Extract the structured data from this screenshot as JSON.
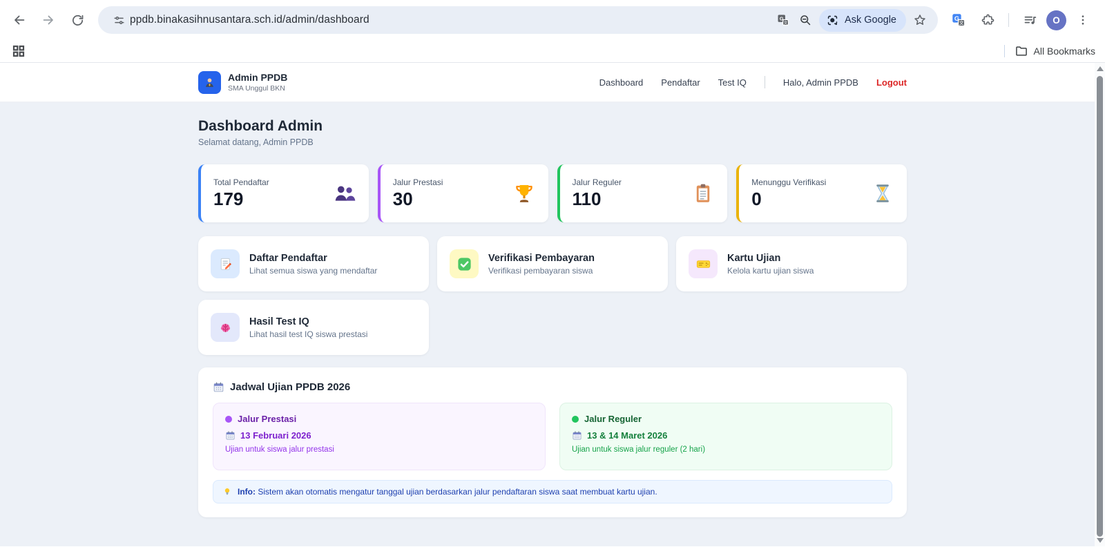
{
  "browser": {
    "url": "ppdb.binakasihnusantara.sch.id/admin/dashboard",
    "ask_google_label": "Ask Google",
    "profile_initial": "O",
    "bookmarks_label": "All Bookmarks",
    "toolbar_icons": [
      "back-icon",
      "forward-icon",
      "reload-icon",
      "site-settings-icon",
      "translate-page-icon",
      "zoom-out-icon",
      "lens-icon",
      "bookmark-star-icon",
      "translate-extension-icon",
      "extensions-icon",
      "playlist-icon",
      "profile-avatar",
      "kebab-menu-icon",
      "apps-grid-icon",
      "folder-icon"
    ]
  },
  "header": {
    "brand_title": "Admin PPDB",
    "brand_subtitle": "SMA Unggul BKN",
    "brand_icon": "office-worker-icon",
    "nav": [
      {
        "label": "Dashboard"
      },
      {
        "label": "Pendaftar"
      },
      {
        "label": "Test IQ"
      }
    ],
    "greeting": "Halo, Admin PPDB",
    "logout_label": "Logout",
    "logout_color": "#dc2626"
  },
  "dashboard": {
    "title": "Dashboard Admin",
    "subtitle": "Selamat datang, Admin PPDB",
    "stats": [
      {
        "label": "Total Pendaftar",
        "value": "179",
        "icon": "people-icon",
        "accent": "#3b82f6"
      },
      {
        "label": "Jalur Prestasi",
        "value": "30",
        "icon": "trophy-icon",
        "accent": "#a855f7"
      },
      {
        "label": "Jalur Reguler",
        "value": "110",
        "icon": "clipboard-icon",
        "accent": "#22c55e"
      },
      {
        "label": "Menunggu Verifikasi",
        "value": "0",
        "icon": "hourglass-icon",
        "accent": "#eab308"
      }
    ],
    "actions": [
      {
        "title": "Daftar Pendaftar",
        "desc": "Lihat semua siswa yang mendaftar",
        "icon": "memo-icon",
        "icon_bg": "#dbeafe"
      },
      {
        "title": "Verifikasi Pembayaran",
        "desc": "Verifikasi pembayaran siswa",
        "icon": "check-icon",
        "icon_bg": "#fef9c3"
      },
      {
        "title": "Kartu Ujian",
        "desc": "Kelola kartu ujian siswa",
        "icon": "ticket-icon",
        "icon_bg": "#f5e8fc"
      },
      {
        "title": "Hasil Test IQ",
        "desc": "Lihat hasil test IQ siswa prestasi",
        "icon": "brain-icon",
        "icon_bg": "#e3e8fb"
      }
    ],
    "schedule": {
      "heading": "Jadwal Ujian PPDB 2026",
      "heading_icon": "calendar-icon",
      "tracks": [
        {
          "name": "Jalur Prestasi",
          "date": "13 Februari 2026",
          "desc": "Ujian untuk siswa jalur prestasi",
          "dot": "#a855f7"
        },
        {
          "name": "Jalur Reguler",
          "date": "13 & 14 Maret 2026",
          "desc": "Ujian untuk siswa jalur reguler (2 hari)",
          "dot": "#22c55e"
        }
      ],
      "info_label": "Info:",
      "info_text": "Sistem akan otomatis mengatur tanggal ujian berdasarkan jalur pendaftaran siswa saat membuat kartu ujian.",
      "info_icon": "bulb-icon"
    }
  }
}
